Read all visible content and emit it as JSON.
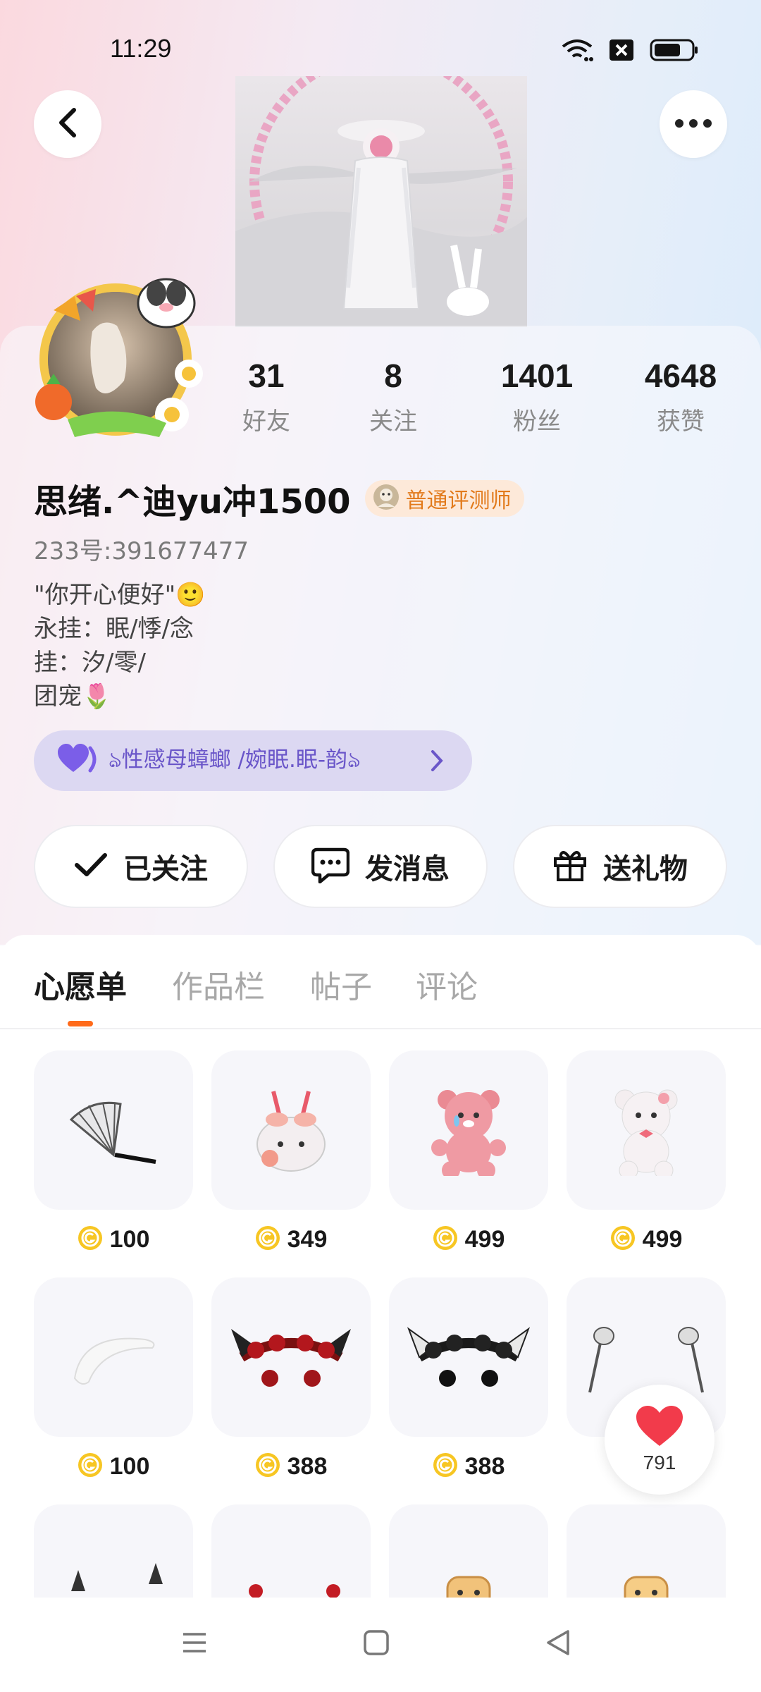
{
  "status_bar": {
    "time": "11:29"
  },
  "stats": [
    {
      "value": "31",
      "label": "好友"
    },
    {
      "value": "8",
      "label": "关注"
    },
    {
      "value": "1401",
      "label": "粉丝"
    },
    {
      "value": "4648",
      "label": "获赞"
    }
  ],
  "profile": {
    "username": "思绪.^迪yu冲1500",
    "badge": "普通评测师",
    "user_id": "233号:391677477",
    "bio": [
      "\"你开心便好\"🙂",
      "永挂：眠/悸/念",
      "挂：汐/零/",
      "团宠🌷"
    ],
    "group": "ঌ性感母蟑螂 /婉眠.眠-韵ঌ"
  },
  "actions": {
    "followed": "已关注",
    "message": "发消息",
    "gift": "送礼物"
  },
  "tabs": [
    "心愿单",
    "作品栏",
    "帖子",
    "评论"
  ],
  "wishlist": [
    {
      "item": "fan",
      "price": "100"
    },
    {
      "item": "bunny-bag",
      "price": "349"
    },
    {
      "item": "pink-bear",
      "price": "499"
    },
    {
      "item": "white-bear",
      "price": "499"
    },
    {
      "item": "white-headband",
      "price": "100"
    },
    {
      "item": "red-butterfly-headband",
      "price": "388"
    },
    {
      "item": "black-butterfly-headband",
      "price": "388"
    },
    {
      "item": "silver-hair-clips",
      "price": ""
    }
  ],
  "like_fab": {
    "count": "791"
  },
  "colors": {
    "accent": "#ff6a1a",
    "group_text": "#6a56c9",
    "badge_text": "#e27a1b",
    "like_red": "#f23b4b"
  }
}
